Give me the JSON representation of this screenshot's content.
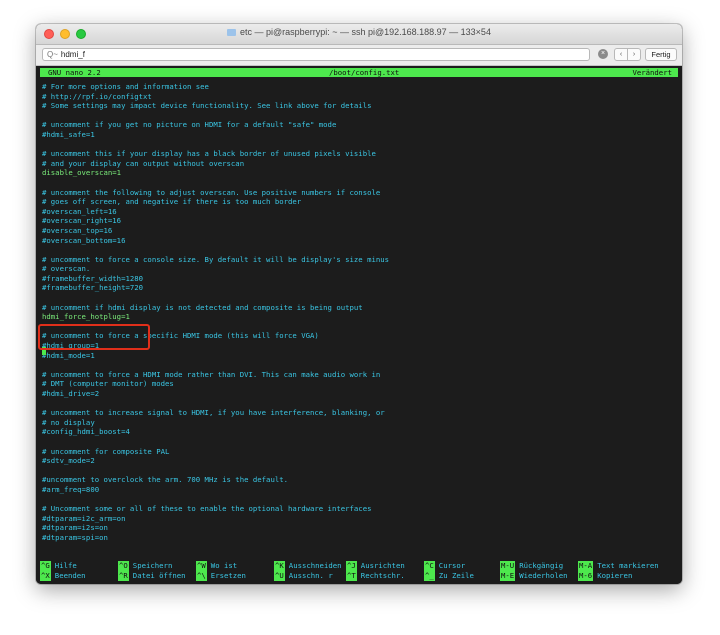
{
  "window": {
    "title": "etc — pi@raspberrypi: ~ — ssh pi@192.168.188.97 — 133×54"
  },
  "findbar": {
    "search_icon_glyph": "Q~",
    "search_value": "hdmi_f",
    "done_label": "Fertig"
  },
  "nano": {
    "version": "GNU nano 2.2",
    "filename": "/boot/config.txt",
    "status": "Verändert"
  },
  "lines": [
    {
      "type": "c",
      "text": "# For more options and information see"
    },
    {
      "type": "c",
      "text": "# http://rpf.io/configtxt"
    },
    {
      "type": "c",
      "text": "# Some settings may impact device functionality. See link above for details"
    },
    {
      "type": "c",
      "text": ""
    },
    {
      "type": "c",
      "text": "# uncomment if you get no picture on HDMI for a default \"safe\" mode"
    },
    {
      "type": "c",
      "text": "#hdmi_safe=1"
    },
    {
      "type": "c",
      "text": ""
    },
    {
      "type": "c",
      "text": "# uncomment this if your display has a black border of unused pixels visible"
    },
    {
      "type": "c",
      "text": "# and your display can output without overscan"
    },
    {
      "type": "s",
      "text": "disable_overscan=1"
    },
    {
      "type": "c",
      "text": ""
    },
    {
      "type": "c",
      "text": "# uncomment the following to adjust overscan. Use positive numbers if console"
    },
    {
      "type": "c",
      "text": "# goes off screen, and negative if there is too much border"
    },
    {
      "type": "c",
      "text": "#overscan_left=16"
    },
    {
      "type": "c",
      "text": "#overscan_right=16"
    },
    {
      "type": "c",
      "text": "#overscan_top=16"
    },
    {
      "type": "c",
      "text": "#overscan_bottom=16"
    },
    {
      "type": "c",
      "text": ""
    },
    {
      "type": "c",
      "text": "# uncomment to force a console size. By default it will be display's size minus"
    },
    {
      "type": "c",
      "text": "# overscan."
    },
    {
      "type": "c",
      "text": "#framebuffer_width=1280"
    },
    {
      "type": "c",
      "text": "#framebuffer_height=720"
    },
    {
      "type": "c",
      "text": ""
    },
    {
      "type": "c",
      "text": "# uncomment if hdmi display is not detected and composite is being output"
    },
    {
      "type": "s",
      "text": "hdmi_force_hotplug=1"
    },
    {
      "type": "c",
      "text": ""
    },
    {
      "type": "c",
      "text": "# uncomment to force a specific HDMI mode (this will force VGA)"
    },
    {
      "type": "c",
      "text": "#hdmi_group=1"
    },
    {
      "type": "c",
      "text": "#hdmi_mode=1"
    },
    {
      "type": "c",
      "text": ""
    },
    {
      "type": "c",
      "text": "# uncomment to force a HDMI mode rather than DVI. This can make audio work in"
    },
    {
      "type": "c",
      "text": "# DMT (computer monitor) modes"
    },
    {
      "type": "c",
      "text": "#hdmi_drive=2"
    },
    {
      "type": "c",
      "text": ""
    },
    {
      "type": "c",
      "text": "# uncomment to increase signal to HDMI, if you have interference, blanking, or"
    },
    {
      "type": "c",
      "text": "# no display"
    },
    {
      "type": "c",
      "text": "#config_hdmi_boost=4"
    },
    {
      "type": "c",
      "text": ""
    },
    {
      "type": "c",
      "text": "# uncomment for composite PAL"
    },
    {
      "type": "c",
      "text": "#sdtv_mode=2"
    },
    {
      "type": "c",
      "text": ""
    },
    {
      "type": "c",
      "text": "#uncomment to overclock the arm. 700 MHz is the default."
    },
    {
      "type": "c",
      "text": "#arm_freq=800"
    },
    {
      "type": "c",
      "text": ""
    },
    {
      "type": "c",
      "text": "# Uncomment some or all of these to enable the optional hardware interfaces"
    },
    {
      "type": "c",
      "text": "#dtparam=i2c_arm=on"
    },
    {
      "type": "c",
      "text": "#dtparam=i2s=on"
    },
    {
      "type": "c",
      "text": "#dtparam=spi=on"
    }
  ],
  "shortcuts": [
    {
      "key": "^G",
      "label": "Hilfe"
    },
    {
      "key": "^X",
      "label": "Beenden"
    },
    {
      "key": "^O",
      "label": "Speichern"
    },
    {
      "key": "^R",
      "label": "Datei öffnen"
    },
    {
      "key": "^W",
      "label": "Wo ist"
    },
    {
      "key": "^\\",
      "label": "Ersetzen"
    },
    {
      "key": "^K",
      "label": "Ausschneiden"
    },
    {
      "key": "^U",
      "label": "Ausschn. r"
    },
    {
      "key": "^J",
      "label": "Ausrichten"
    },
    {
      "key": "^T",
      "label": "Rechtschr."
    },
    {
      "key": "^C",
      "label": "Cursor"
    },
    {
      "key": "^_",
      "label": "Zu Zeile"
    },
    {
      "key": "M-U",
      "label": "Rückgängig"
    },
    {
      "key": "M-E",
      "label": "Wiederholen"
    },
    {
      "key": "M-A",
      "label": "Text markieren"
    },
    {
      "key": "M-6",
      "label": "Kopieren"
    }
  ],
  "colors": {
    "nano_green": "#4de84d",
    "comment_cyan": "#3ac6e4",
    "highlight_red": "#e02f1a"
  }
}
